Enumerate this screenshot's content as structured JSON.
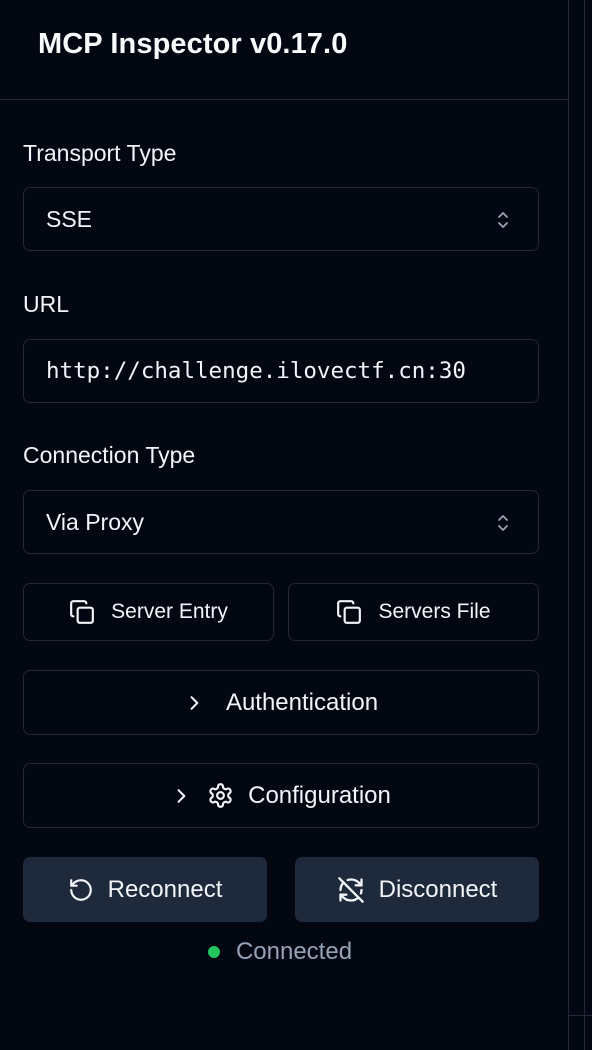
{
  "header": {
    "title": "MCP Inspector v0.17.0"
  },
  "transport": {
    "label": "Transport Type",
    "value": "SSE"
  },
  "url": {
    "label": "URL",
    "value": "http://challenge.ilovectf.cn:30"
  },
  "connection": {
    "label": "Connection Type",
    "value": "Via Proxy"
  },
  "buttons": {
    "server_entry": "Server Entry",
    "servers_file": "Servers File",
    "authentication": "Authentication",
    "configuration": "Configuration",
    "reconnect": "Reconnect",
    "disconnect": "Disconnect"
  },
  "icons": {
    "copy": "copy-icon",
    "chevron_right": "chevron-right-icon",
    "gear": "gear-icon",
    "reconnect": "rotate-ccw-icon",
    "disconnect": "refresh-off-icon",
    "select": "chevrons-up-down-icon"
  },
  "status": {
    "text": "Connected",
    "color": "#22c55e"
  }
}
